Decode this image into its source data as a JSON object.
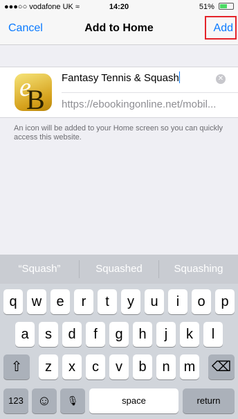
{
  "status_bar": {
    "carrier": "●●●○○ vodafone UK ≈",
    "time": "14:20",
    "battery": "51%"
  },
  "nav": {
    "cancel_label": "Cancel",
    "title": "Add to Home",
    "add_label": "Add"
  },
  "form": {
    "icon_letters": {
      "first": "e",
      "second": "B"
    },
    "name_value": "Fantasy Tennis & Squash",
    "url_value": "https://ebookingonline.net/mobil..."
  },
  "hint_text": "An icon will be added to your Home screen so you can quickly access this website.",
  "keyboard": {
    "suggestions": [
      "“Squash”",
      "Squashed",
      "Squashing"
    ],
    "row1": [
      "q",
      "w",
      "e",
      "r",
      "t",
      "y",
      "u",
      "i",
      "o",
      "p"
    ],
    "row2": [
      "a",
      "s",
      "d",
      "f",
      "g",
      "h",
      "j",
      "k",
      "l"
    ],
    "row3": [
      "z",
      "x",
      "c",
      "v",
      "b",
      "n",
      "m"
    ],
    "shift": "⇧",
    "delete": "⌫",
    "numbers": "123",
    "emoji": "☺",
    "mic": "🎙",
    "space": "space",
    "return": "return"
  }
}
